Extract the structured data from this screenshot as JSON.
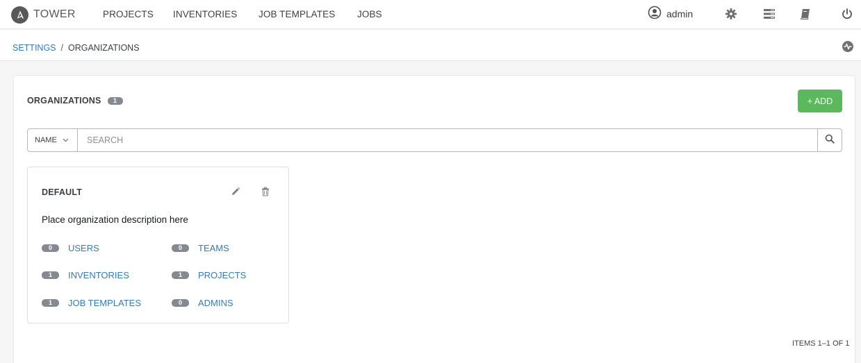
{
  "app": {
    "brand": "TOWER"
  },
  "nav": {
    "links": [
      "PROJECTS",
      "INVENTORIES",
      "JOB TEMPLATES",
      "JOBS"
    ],
    "user": "admin"
  },
  "breadcrumb": {
    "parent": "SETTINGS",
    "separator": "/",
    "current": "ORGANIZATIONS"
  },
  "panel": {
    "title": "ORGANIZATIONS",
    "count": "1",
    "add_label": "+ ADD"
  },
  "search": {
    "field": "NAME",
    "placeholder": "SEARCH"
  },
  "organizations": [
    {
      "name": "DEFAULT",
      "description": "Place organization description here",
      "links": [
        {
          "count": "0",
          "label": "USERS"
        },
        {
          "count": "0",
          "label": "TEAMS"
        },
        {
          "count": "1",
          "label": "INVENTORIES"
        },
        {
          "count": "1",
          "label": "PROJECTS"
        },
        {
          "count": "1",
          "label": "JOB TEMPLATES"
        },
        {
          "count": "0",
          "label": "ADMINS"
        }
      ]
    }
  ],
  "pagination": {
    "text": "ITEMS 1–1 OF 1"
  },
  "colors": {
    "link": "#337ab7",
    "add_button": "#5cb85c",
    "badge": "#848992"
  },
  "icons": {
    "logo": "ansible-logo-icon",
    "user": "user-circle-icon",
    "settings": "gear-icon",
    "inventory": "server-stack-icon",
    "docs": "book-icon",
    "logout": "power-icon",
    "activity": "activity-stream-icon",
    "edit": "pencil-icon",
    "delete": "trash-icon",
    "search": "search-icon",
    "dropdown": "chevron-down-icon"
  }
}
